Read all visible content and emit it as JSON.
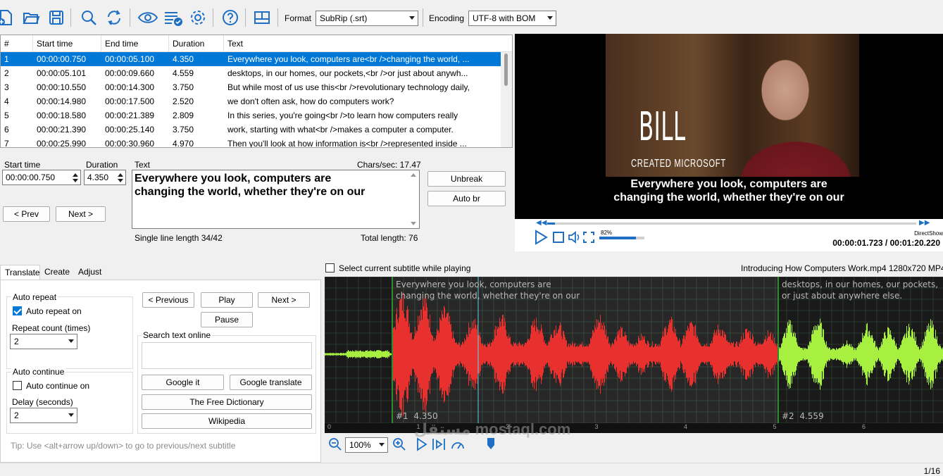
{
  "toolbar": {
    "icons": [
      "new-file-icon",
      "open-folder-icon",
      "save-icon",
      "search-icon",
      "replace-icon",
      "preview-eye-icon",
      "spellcheck-icon",
      "settings-gear-icon",
      "help-icon",
      "layout-icon"
    ],
    "format_label": "Format",
    "format_value": "SubRip (.srt)",
    "encoding_label": "Encoding",
    "encoding_value": "UTF-8 with BOM"
  },
  "grid": {
    "headers": [
      "#",
      "Start time",
      "End time",
      "Duration",
      "Text"
    ],
    "rows": [
      {
        "num": "1",
        "start": "00:00:00.750",
        "end": "00:00:05.100",
        "dur": "4.350",
        "text": "Everywhere you look, computers are<br />changing the world, ..."
      },
      {
        "num": "2",
        "start": "00:00:05.101",
        "end": "00:00:09.660",
        "dur": "4.559",
        "text": "desktops, in our homes, our pockets,<br />or just about anywh..."
      },
      {
        "num": "3",
        "start": "00:00:10.550",
        "end": "00:00:14.300",
        "dur": "3.750",
        "text": "But while most of us use this<br />revolutionary technology daily,"
      },
      {
        "num": "4",
        "start": "00:00:14.980",
        "end": "00:00:17.500",
        "dur": "2.520",
        "text": "we don't often ask, how do computers work?"
      },
      {
        "num": "5",
        "start": "00:00:18.580",
        "end": "00:00:21.389",
        "dur": "2.809",
        "text": "In this series, you're going<br />to learn how computers really"
      },
      {
        "num": "6",
        "start": "00:00:21.390",
        "end": "00:00:25.140",
        "dur": "3.750",
        "text": "work, starting with what<br />makes a computer a computer."
      },
      {
        "num": "7",
        "start": "00:00:25.990",
        "end": "00:00:30.960",
        "dur": "4.970",
        "text": "Then you'll look at how information is<br />represented inside ..."
      }
    ]
  },
  "editor": {
    "start_label": "Start time",
    "start_value": "00:00:00.750",
    "duration_label": "Duration",
    "duration_value": "4.350",
    "text_label": "Text",
    "chars_sec": "Chars/sec: 17.47",
    "text_line1": "Everywhere you look, computers are",
    "text_line2": "changing the world, whether they're on our",
    "prev": "< Prev",
    "next": "Next >",
    "unbreak": "Unbreak",
    "auto_br": "Auto br",
    "single_line": "Single line length 34/42",
    "total_length": "Total length: 76"
  },
  "video": {
    "overlay_name": "BILL",
    "overlay_sub": "CREATED MICROSOFT",
    "sub_line1": "Everywhere you look, computers are",
    "sub_line2": "changing the world, whether they're on our",
    "volume": "82%",
    "volume_level": 0.82,
    "renderer": "DirectShow",
    "time": "00:00:01.723 / 00:01:20.220",
    "progress": 0.021
  },
  "tabs": [
    "Translate",
    "Create",
    "Adjust"
  ],
  "translate": {
    "auto_repeat_title": "Auto repeat",
    "auto_repeat_on": "Auto repeat on",
    "repeat_count_label": "Repeat count (times)",
    "repeat_count_value": "2",
    "auto_continue_title": "Auto continue",
    "auto_continue_on": "Auto continue on",
    "delay_label": "Delay (seconds)",
    "delay_value": "2",
    "previous": "< Previous",
    "play": "Play",
    "next": "Next >",
    "pause": "Pause",
    "search_online": "Search text online",
    "google_it": "Google it",
    "google_translate": "Google translate",
    "free_dictionary": "The Free Dictionary",
    "wikipedia": "Wikipedia",
    "tip": "Tip: Use <alt+arrow up/down> to go to previous/next subtitle"
  },
  "wave": {
    "select_current": "Select current subtitle while playing",
    "file_info": "Introducing How Computers Work.mp4 1280x720 MP4",
    "sub1_line1": "Everywhere you look, computers are",
    "sub1_line2": "changing the world, whether they're on our",
    "sub2_line1": "desktops, in our homes, our pockets,",
    "sub2_line2": "or just about anywhere else.",
    "sub1_tag": "#1  4.350",
    "sub2_tag": "#2  4.559",
    "ticks": [
      "0",
      "1",
      "2",
      "3",
      "4",
      "5",
      "6"
    ],
    "zoom": "100%",
    "colors": {
      "current": "#e8312e",
      "next": "#a8f040",
      "bg": "#1a1a1a"
    }
  },
  "status": {
    "page": "1/16"
  },
  "watermark": "مستقل mostaql.com"
}
